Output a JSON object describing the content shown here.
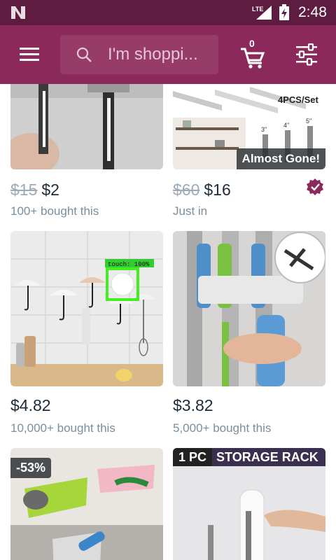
{
  "status_bar": {
    "network": "LTE",
    "time": "2:48"
  },
  "app_bar": {
    "search_placeholder": "I'm shoppi...",
    "cart_count": "0"
  },
  "products": [
    {
      "old_price": "$15",
      "price": "$2",
      "subtitle": "100+ bought this"
    },
    {
      "old_price": "$60",
      "price": "$16",
      "subtitle": "Just in",
      "badge": "Almost Gone!",
      "image_text": "4PCS/Set",
      "dims": [
        "3\"",
        "4\"",
        "5\""
      ]
    },
    {
      "price": "$4.82",
      "subtitle": "10,000+ bought this",
      "overlay": "touch: 100%"
    },
    {
      "price": "$3.82",
      "subtitle": "5,000+ bought this"
    },
    {
      "badge": "-53%"
    },
    {
      "banner_left": "1 PC",
      "banner_right": "STORAGE RACK"
    }
  ],
  "colors": {
    "brand": "#8b2a5a",
    "status_bar": "#5e1d40",
    "price": "#1d2a3a",
    "subtitle": "#7a8e9e"
  }
}
